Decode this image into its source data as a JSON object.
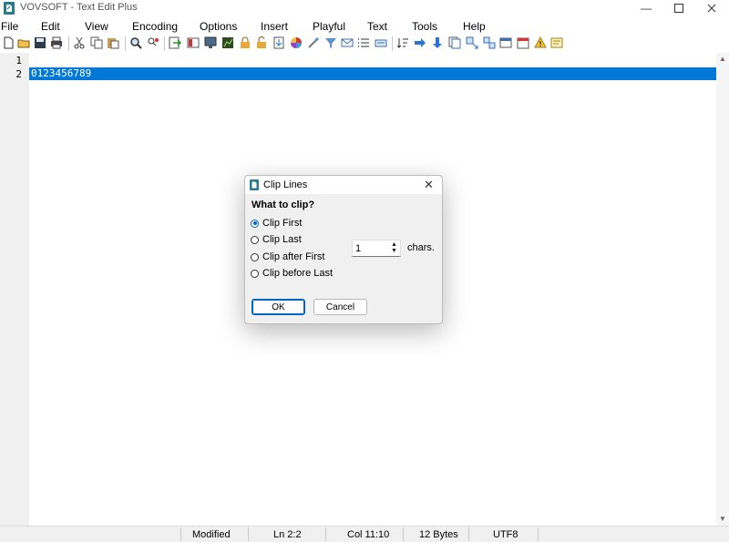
{
  "window": {
    "title": "VOVSOFT - Text Edit Plus",
    "icon": "app-logo-icon",
    "controls": [
      "minimize-icon",
      "maximize-icon",
      "close-icon"
    ]
  },
  "menu": {
    "items": [
      "File",
      "Edit",
      "View",
      "Encoding",
      "Options",
      "Insert",
      "Playful",
      "Text",
      "Tools",
      "Help"
    ]
  },
  "toolbar": {
    "icons": [
      "new-file-icon",
      "open-folder-icon",
      "save-icon",
      "print-icon",
      "cut-icon",
      "copy-icon",
      "paste-icon",
      "find-icon",
      "replace-icon",
      "goto-icon",
      "book-icon",
      "monitor-icon",
      "chart-icon",
      "lock-icon",
      "unlock-icon",
      "export-icon",
      "color-wheel-icon",
      "brush-icon",
      "filter-icon",
      "mail-icon",
      "list-icon",
      "keyboard-icon",
      "sort-icon",
      "arrow-right-icon",
      "arrow-down-icon",
      "document-icon",
      "swap-icon",
      "shuffle-icon",
      "window-icon",
      "calendar-icon",
      "warning-icon",
      "note-icon"
    ]
  },
  "editor": {
    "line_numbers": [
      "1",
      "2"
    ],
    "lines": [
      "",
      "0123456789"
    ],
    "selection_color": "#0078d7"
  },
  "status": {
    "modified": "Modified",
    "position_line": "Ln 2:2",
    "position_col": "Col 11:10",
    "size": "12 Bytes",
    "encoding": "UTF8"
  },
  "dialog": {
    "title": "Clip Lines",
    "question": "What to clip?",
    "options": [
      {
        "label": "Clip First",
        "checked": true
      },
      {
        "label": "Clip Last",
        "checked": false
      },
      {
        "label": "Clip after First",
        "checked": false
      },
      {
        "label": "Clip before Last",
        "checked": false
      }
    ],
    "count_value": "1",
    "count_unit": "chars.",
    "ok_label": "OK",
    "cancel_label": "Cancel",
    "accent_color": "#0067c0"
  }
}
